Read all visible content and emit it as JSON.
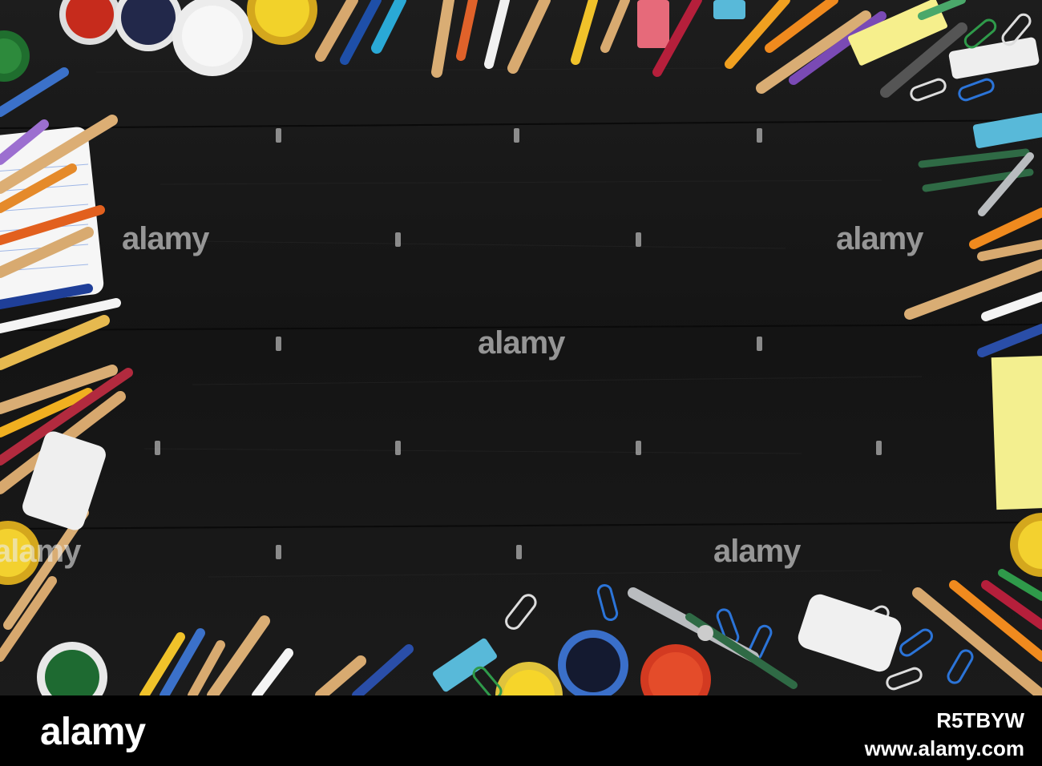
{
  "image": {
    "subject": "school-supplies-frame",
    "background_color": "#1a1a1a"
  },
  "watermark": {
    "text": "alamy"
  },
  "footer": {
    "logo": "alamy",
    "image_id": "R5TBYW",
    "url": "www.alamy.com"
  }
}
